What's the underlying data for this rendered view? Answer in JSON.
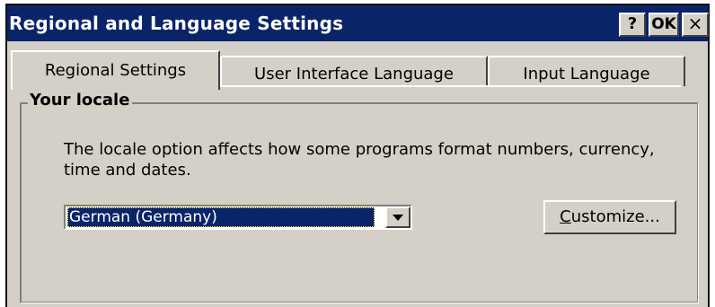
{
  "window": {
    "title": "Regional and Language Settings",
    "help_label": "?",
    "ok_label": "OK",
    "close_label": "×"
  },
  "tabs": [
    {
      "label": "Regional Settings",
      "active": true
    },
    {
      "label": "User Interface Language",
      "active": false
    },
    {
      "label": "Input Language",
      "active": false
    }
  ],
  "locale_group": {
    "title": "Your locale",
    "description": "The locale option affects how some programs format numbers, currency, time and dates.",
    "selected_locale": "German (Germany)",
    "dropdown_icon": "chevron-down-icon",
    "customize_accel": "C",
    "customize_rest": "ustomize..."
  },
  "colors": {
    "titlebar": "#0a246a",
    "face": "#d4d0c8",
    "selection": "#0a246a"
  }
}
